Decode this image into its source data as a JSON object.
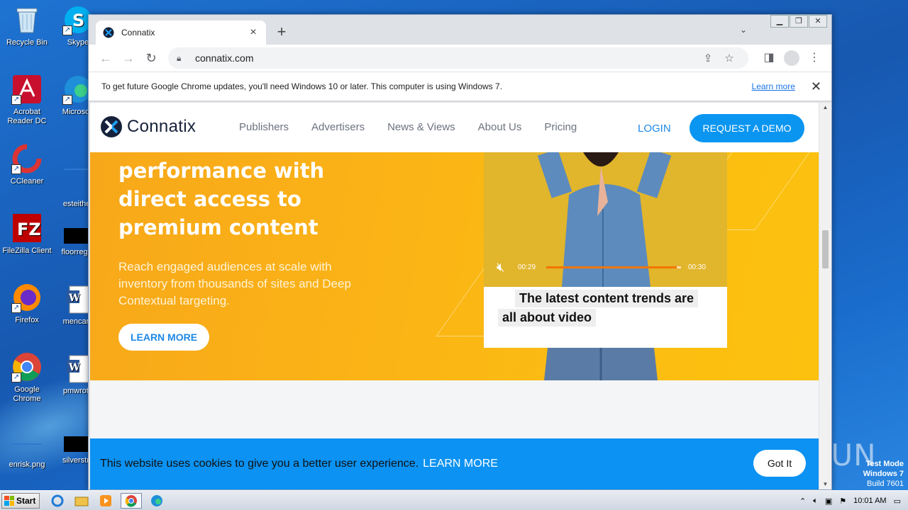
{
  "desktop": {
    "icons_col1": [
      {
        "label": "Recycle Bin"
      },
      {
        "label": "Acrobat Reader DC"
      },
      {
        "label": "CCleaner"
      },
      {
        "label": "FileZilla Client"
      },
      {
        "label": "Firefox"
      },
      {
        "label": "Google Chrome"
      },
      {
        "label": "enrisk.png"
      }
    ],
    "icons_col2": [
      {
        "label": "Skype"
      },
      {
        "label": "Microsoft"
      },
      {
        "label": "esteither"
      },
      {
        "label": "floorregar"
      },
      {
        "label": "mencare"
      },
      {
        "label": "pmwrote"
      },
      {
        "label": "silverstru"
      }
    ]
  },
  "browser": {
    "tab_title": "Connatix",
    "url": "connatix.com",
    "infobar": {
      "message": "To get future Google Chrome updates, you'll need Windows 10 or later. This computer is using Windows 7.",
      "link": "Learn more"
    }
  },
  "site": {
    "logo_text": "Connatix",
    "nav": [
      "Publishers",
      "Advertisers",
      "News & Views",
      "About Us",
      "Pricing"
    ],
    "login": "LOGIN",
    "demo_button": "REQUEST A DEMO",
    "hero": {
      "headline_lines": [
        "performance with",
        "direct access to",
        "premium content"
      ],
      "subtext": "Reach engaged audiences at scale with inventory from thousands of sites and Deep Contextual targeting.",
      "cta": "LEARN MORE"
    },
    "video": {
      "time_current": "00:29",
      "time_total": "00:30",
      "progress": 0.97,
      "caption_line1": "The latest content trends are",
      "caption_line2": "all about video"
    },
    "cookie": {
      "text": "This website uses cookies to give you a better user experience.",
      "learn": "LEARN MORE",
      "button": "Got It"
    }
  },
  "watermark": "ANY RUN",
  "os": {
    "test_mode": [
      "Test Mode",
      "Windows 7",
      "Build 7601"
    ],
    "start_label": "Start",
    "clock": "10:01 AM"
  }
}
